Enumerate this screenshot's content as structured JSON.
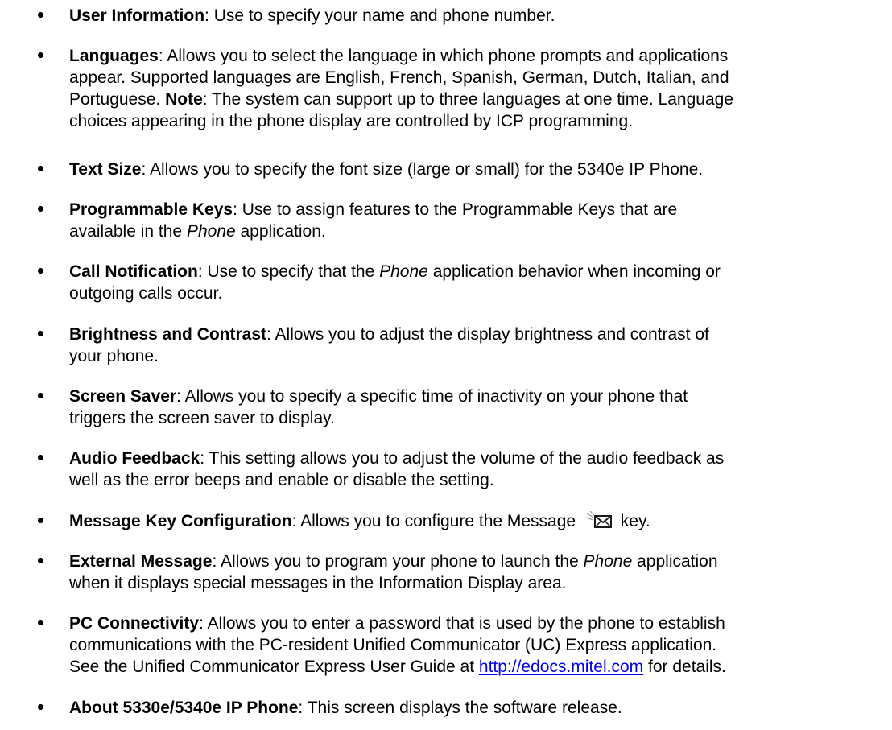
{
  "items": [
    {
      "term": "User Information",
      "lines": [
        ": Use to specify your name and phone number."
      ]
    },
    {
      "term": "Languages",
      "lines": [
        ": Allows you to select the language in which phone prompts and applications",
        "appear. Supported languages are English, French, Spanish, German, Dutch, Italian, and",
        "Portuguese. ",
        "choices appearing in the phone display are controlled by ICP programming."
      ],
      "note_label": "Note",
      "note_text": ": The system can support up to three languages at one time. Language"
    },
    {
      "term": "Text Size",
      "lines": [
        ": Allows you to specify the font size (large or small) for the 5340e IP Phone."
      ]
    },
    {
      "term": "Programmable Keys",
      "lines": [
        ": Use to assign features to the Programmable Keys that are",
        "available in the ",
        " application."
      ],
      "italic": "Phone"
    },
    {
      "term": "Call Notification",
      "lines": [
        ": Use to specify that the ",
        " application behavior when incoming or",
        "outgoing calls occur."
      ],
      "italic": "Phone"
    },
    {
      "term": "Brightness and Contrast",
      "lines": [
        ": Allows you to adjust the display brightness and contrast of",
        "your phone."
      ]
    },
    {
      "term": "Screen Saver",
      "lines": [
        ": Allows you to specify a specific time of inactivity on your phone that",
        "triggers the screen saver to display."
      ]
    },
    {
      "term": "Audio Feedback",
      "lines": [
        ": This setting allows you to adjust the volume of the audio feedback as",
        "well as the error beeps and enable or disable the setting."
      ]
    },
    {
      "term": "Message Key Configuration",
      "lines": [
        ": Allows you to configure the Message ",
        " key."
      ],
      "icon": "message-envelope-icon"
    },
    {
      "term": "External Message",
      "lines": [
        ": Allows you to program your phone to launch the ",
        " application",
        "when it displays special messages in the Information Display area."
      ],
      "italic": "Phone"
    },
    {
      "term": "PC Connectivity",
      "lines": [
        ": Allows you to enter a password that is used by the phone to establish",
        "communications with the PC-resident Unified Communicator (UC) Express application.",
        "See the Unified Communicator Express User Guide at ",
        " for details."
      ],
      "link": "http://edocs.mitel.com"
    },
    {
      "term": "About 5330e/5340e IP Phone",
      "lines": [
        ": This screen displays the software release."
      ]
    }
  ]
}
